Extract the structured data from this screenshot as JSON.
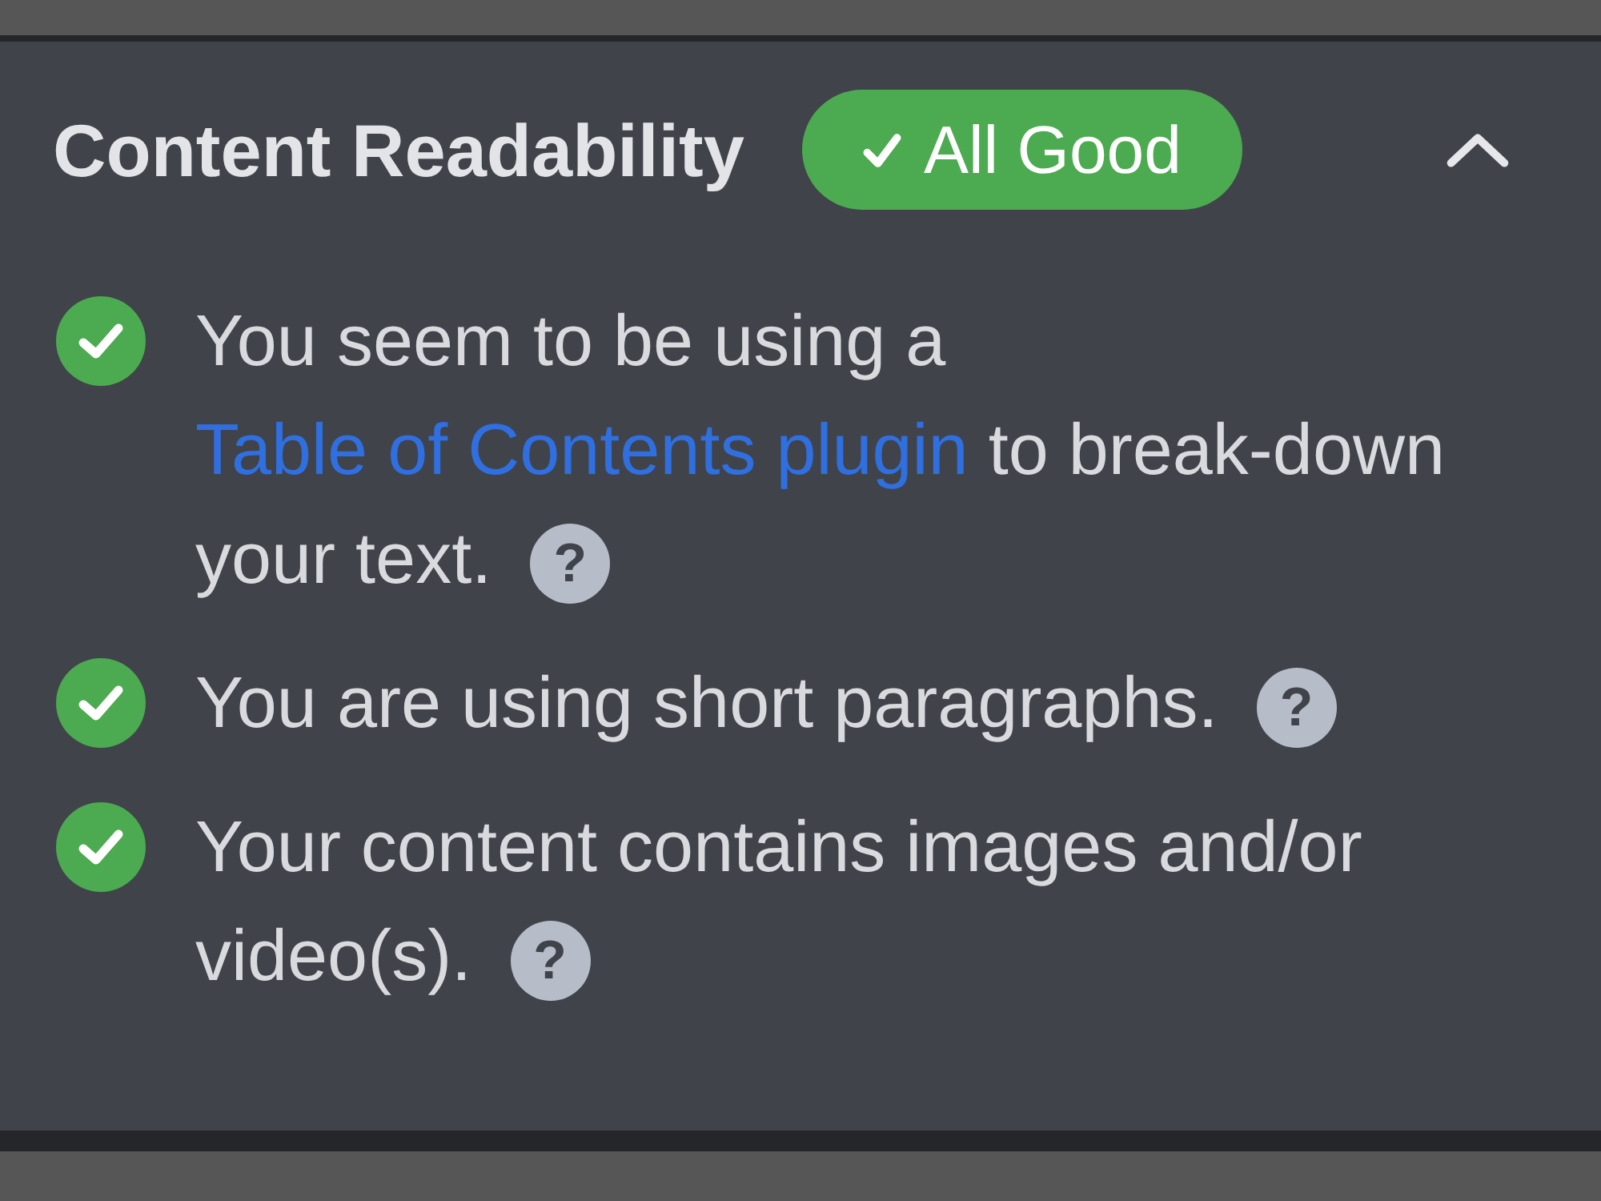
{
  "panel": {
    "title": "Content Readability",
    "status": {
      "kind": "good",
      "label": "All Good"
    },
    "expanded": true,
    "checks": [
      {
        "passed": true,
        "parts": [
          {
            "kind": "text",
            "text": "You seem to be using a "
          },
          {
            "kind": "link",
            "text": "Table of Contents plugin"
          },
          {
            "kind": "text",
            "text": " to break-down your text."
          }
        ],
        "help": "?"
      },
      {
        "passed": true,
        "parts": [
          {
            "kind": "text",
            "text": "You are using short paragraphs."
          }
        ],
        "help": "?"
      },
      {
        "passed": true,
        "parts": [
          {
            "kind": "text",
            "text": "Your content contains images and/or video(s)."
          }
        ],
        "help": "?"
      }
    ]
  }
}
